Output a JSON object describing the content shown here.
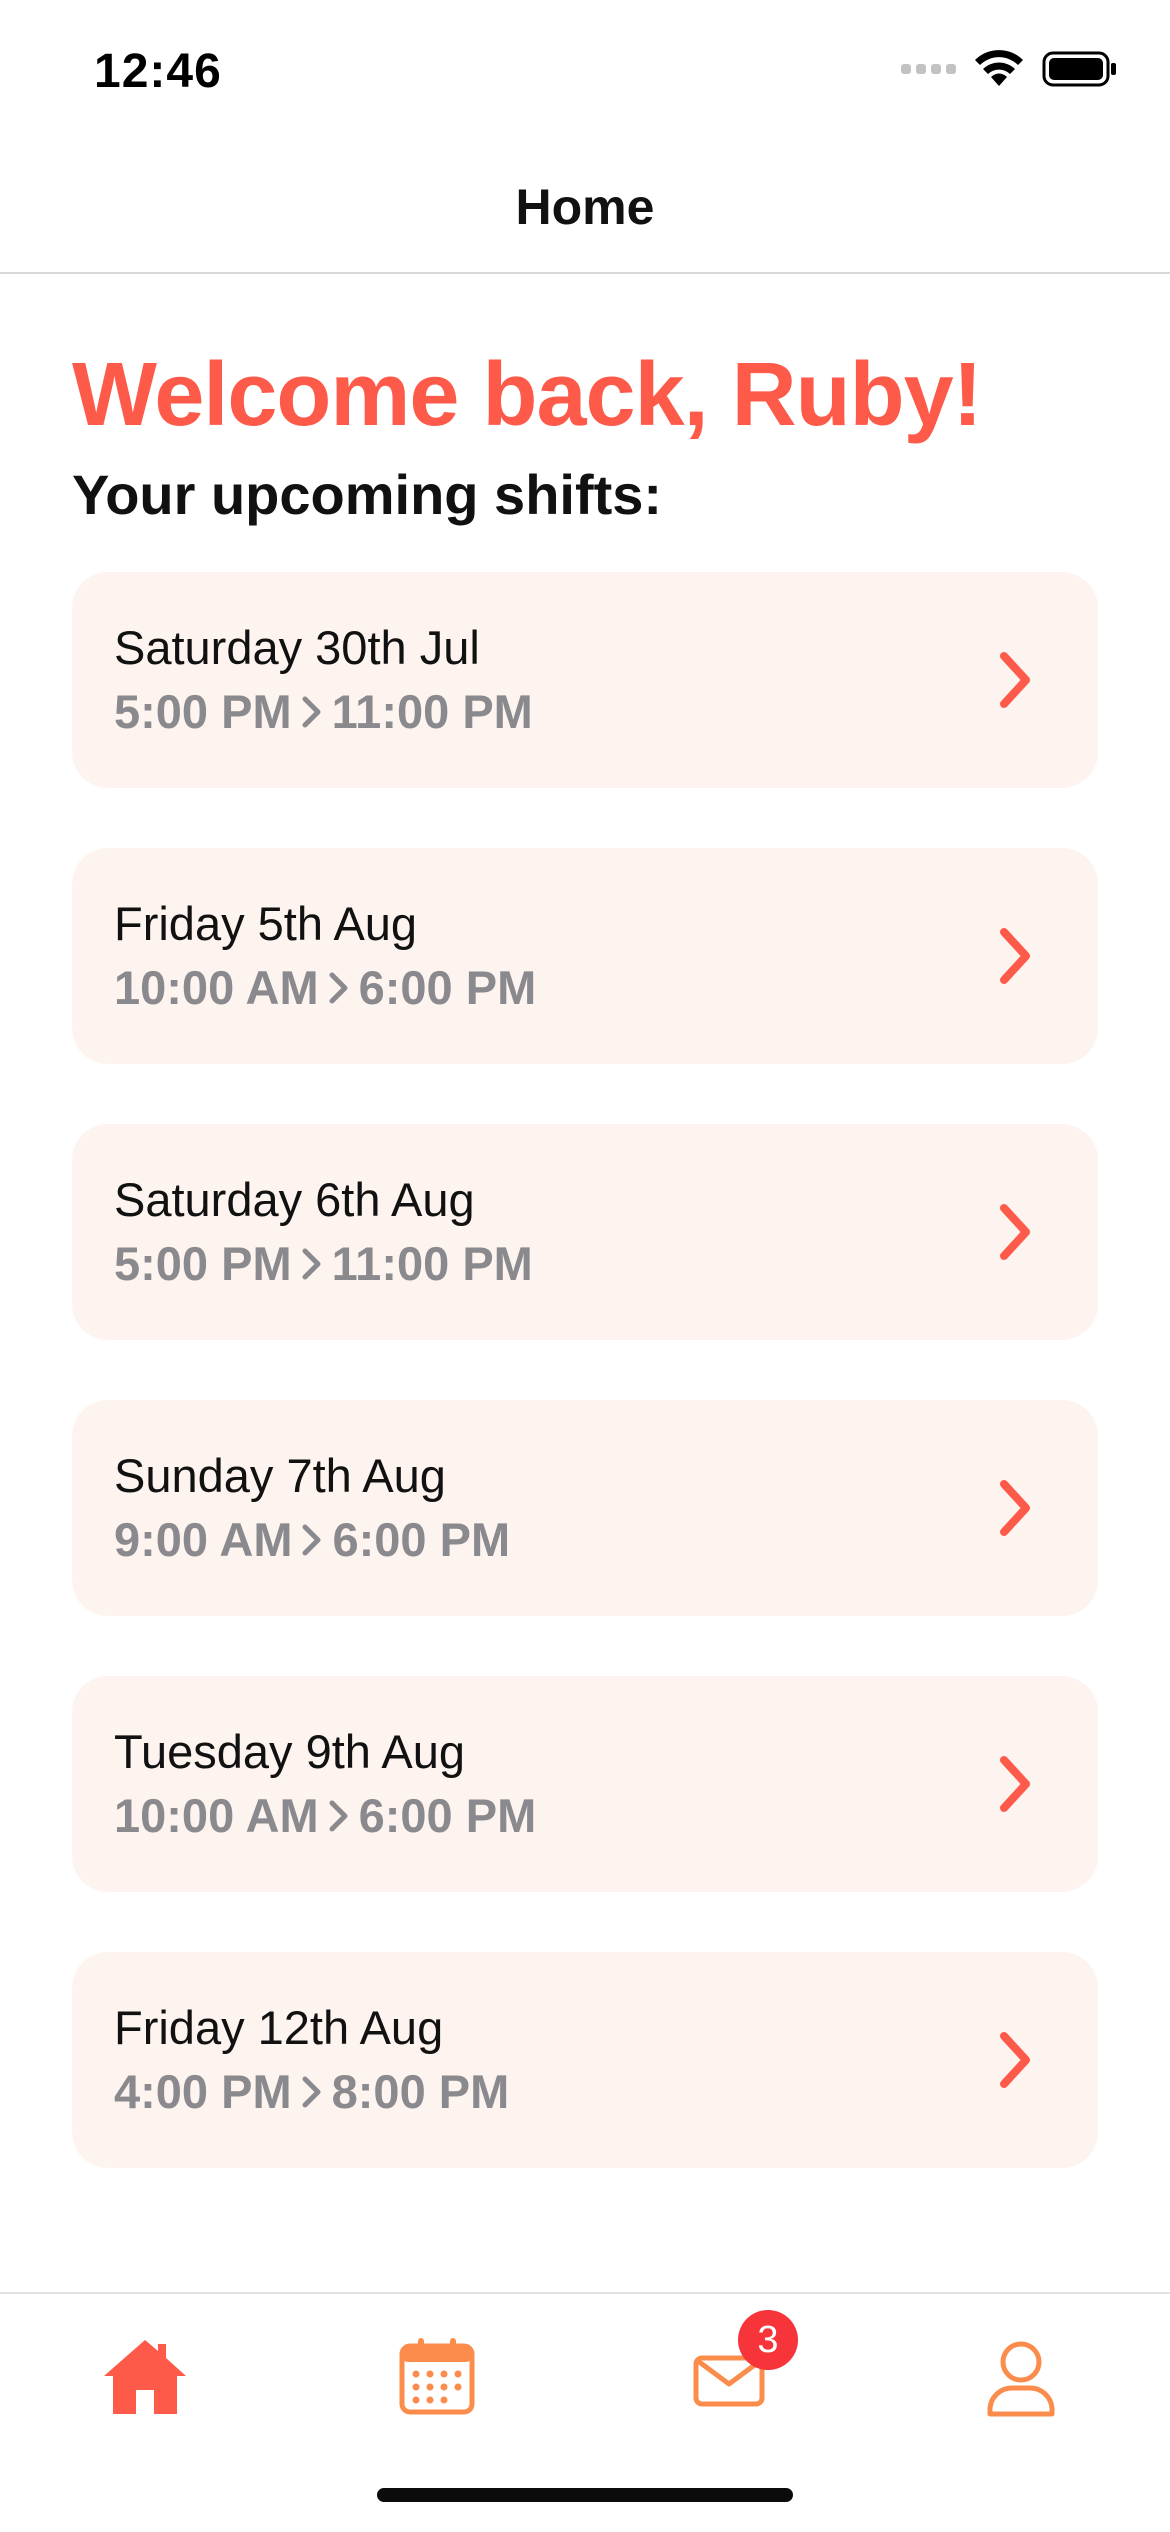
{
  "status_bar": {
    "time": "12:46"
  },
  "nav": {
    "title": "Home"
  },
  "welcome": "Welcome back, Ruby!",
  "subheading": "Your upcoming shifts:",
  "shifts": [
    {
      "date": "Saturday 30th Jul",
      "start": "5:00 PM",
      "end": "11:00 PM"
    },
    {
      "date": "Friday 5th Aug",
      "start": "10:00 AM",
      "end": "6:00 PM"
    },
    {
      "date": "Saturday 6th Aug",
      "start": "5:00 PM",
      "end": "11:00 PM"
    },
    {
      "date": "Sunday 7th Aug",
      "start": "9:00 AM",
      "end": "6:00 PM"
    },
    {
      "date": "Tuesday 9th Aug",
      "start": "10:00 AM",
      "end": "6:00 PM"
    },
    {
      "date": "Friday 12th Aug",
      "start": "4:00 PM",
      "end": "8:00 PM"
    }
  ],
  "tab_bar": {
    "items": [
      {
        "icon": "home-icon",
        "active": true
      },
      {
        "icon": "calendar-icon",
        "active": false
      },
      {
        "icon": "mail-icon",
        "active": false
      },
      {
        "icon": "person-icon",
        "active": false
      }
    ],
    "inbox_badge": "3"
  },
  "colors": {
    "accent": "#fe5a4a",
    "tab_inactive": "#fb8c4b",
    "card_bg": "#fdf3ef",
    "secondary_text": "#8a8a8e",
    "badge": "#f6343a"
  }
}
